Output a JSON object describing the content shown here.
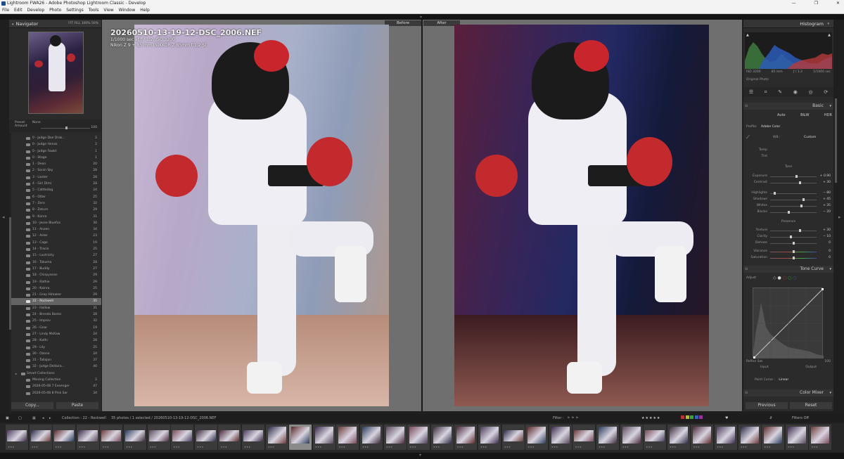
{
  "window": {
    "title": "Lightroom FWA26 - Adobe Photoshop Lightroom Classic - Develop"
  },
  "menu": [
    "File",
    "Edit",
    "Develop",
    "Photo",
    "Settings",
    "Tools",
    "View",
    "Window",
    "Help"
  ],
  "navigator": {
    "title": "Navigator",
    "zoom": "FIT  FILL  100%  50%"
  },
  "preset": {
    "label": "Preset:",
    "value": "None",
    "amount_label": "Amount",
    "amount_value": "100"
  },
  "collections": [
    {
      "name": "0 - Judge Doe Drak...",
      "count": "2"
    },
    {
      "name": "0 - Judge Henzo",
      "count": "2"
    },
    {
      "name": "0 - Judge Fawkt",
      "count": "1"
    },
    {
      "name": "0 - Stage",
      "count": "1"
    },
    {
      "name": "1 - Dean",
      "count": "20"
    },
    {
      "name": "2 - Sonin Sky",
      "count": "28"
    },
    {
      "name": "3 - Lanter",
      "count": "28"
    },
    {
      "name": "4 - Girl Dimi",
      "count": "28"
    },
    {
      "name": "5 - Cattledog",
      "count": "24"
    },
    {
      "name": "6 - Otter",
      "count": "25"
    },
    {
      "name": "7 - Zero",
      "count": "32"
    },
    {
      "name": "8 - Zaturn",
      "count": "29"
    },
    {
      "name": "9 - Kanra",
      "count": "31"
    },
    {
      "name": "10 - Jesse Bluefox",
      "count": "30"
    },
    {
      "name": "11 - Anzen",
      "count": "34"
    },
    {
      "name": "12 - Aster",
      "count": "23"
    },
    {
      "name": "13 - Cage",
      "count": "19"
    },
    {
      "name": "14 - Tracie",
      "count": "25"
    },
    {
      "name": "15 - Lustricity",
      "count": "27"
    },
    {
      "name": "16 - Takuma",
      "count": "28"
    },
    {
      "name": "17 - Buddy",
      "count": "27"
    },
    {
      "name": "18 - Chirpysean",
      "count": "29"
    },
    {
      "name": "19 - Rathie",
      "count": "29"
    },
    {
      "name": "20 - Kainra",
      "count": "25"
    },
    {
      "name": "21 - Gray Himaker",
      "count": "29"
    },
    {
      "name": "22 - Rockwell",
      "count": "35",
      "selected": true
    },
    {
      "name": "23 - Hallow",
      "count": "31"
    },
    {
      "name": "24 - Brenda Banks",
      "count": "28"
    },
    {
      "name": "25 - Improv",
      "count": "32"
    },
    {
      "name": "26 - Gnar",
      "count": "19"
    },
    {
      "name": "27 - Lindy McKaw",
      "count": "24"
    },
    {
      "name": "28 - Kathi",
      "count": "28"
    },
    {
      "name": "29 - Lily",
      "count": "25"
    },
    {
      "name": "30 - Ozone",
      "count": "24"
    },
    {
      "name": "31 - Tallajon",
      "count": "37"
    },
    {
      "name": "32 - Judge Dellaira...",
      "count": "40"
    },
    {
      "name": "Smart Collections",
      "count": "",
      "group": true
    },
    {
      "name": "Missing Collection",
      "count": "2"
    },
    {
      "name": "2026-05-08 7 Eesenger",
      "count": "47"
    },
    {
      "name": "2026-05-08 8 Pink Sar",
      "count": "34"
    }
  ],
  "left_buttons": {
    "copy": "Copy...",
    "paste": "Paste"
  },
  "view": {
    "before": "Before",
    "after": "After"
  },
  "photo_info": {
    "filename": "20260510-13-19-12-DSC_2006.NEF",
    "exposure": "1/1000 sec at ƒ / 1.2, ISO 3200",
    "lens": "Nikon Z 9 + 85 mm (NIKKOR Z 85mm f/1.2 S)"
  },
  "histogram": {
    "title": "Histogram",
    "iso": "ISO 3200",
    "focal": "85 mm",
    "aperture": "ƒ / 1.2",
    "shutter": "1/1000 sec",
    "original": "Original Photo"
  },
  "basic": {
    "title": "Basic",
    "treatment": [
      "Auto",
      "B&W",
      "HDR"
    ],
    "profile_label": "Profile:",
    "profile": "Adobe Color",
    "wb_label": "WB :",
    "wb": "Custom",
    "temp_label": "Temp",
    "tint_label": "Tint",
    "tone_label": "Tone",
    "presence_label": "Presence",
    "sliders": [
      {
        "label": "Exposure",
        "value": "+ 0.90",
        "pos": 0.57
      },
      {
        "label": "Contrast",
        "value": "+ 30",
        "pos": 0.65
      },
      {
        "label": "Highlights",
        "value": "− 80",
        "pos": 0.1
      },
      {
        "label": "Shadows",
        "value": "+ 45",
        "pos": 0.72
      },
      {
        "label": "Whites",
        "value": "+ 35",
        "pos": 0.67
      },
      {
        "label": "Blacks",
        "value": "− 20",
        "pos": 0.4
      },
      {
        "label": "Texture",
        "value": "+ 30",
        "pos": 0.65
      },
      {
        "label": "Clarity",
        "value": "− 10",
        "pos": 0.45
      },
      {
        "label": "Dehaze",
        "value": "0",
        "pos": 0.5
      },
      {
        "label": "Vibrance",
        "value": "0",
        "pos": 0.5
      },
      {
        "label": "Saturation",
        "value": "0",
        "pos": 0.5
      }
    ]
  },
  "tone_curve": {
    "title": "Tone Curve",
    "adjust": "Adjust",
    "refine": "Refine Sat.",
    "refine_val": "100",
    "input": "Input",
    "output": "Output",
    "point_curve_label": "Point Curve :",
    "point_curve": "Linear"
  },
  "color_mixer": {
    "title": "Color Mixer"
  },
  "right_buttons": {
    "previous": "Previous",
    "reset": "Reset"
  },
  "bottom_bar": {
    "collection": "Collection : 22 - Rockwell",
    "count": "35 photos / 1 selected / 20260510-13-19-12-DSC_2006.NEF",
    "filter_label": "Filter :",
    "filters_off": "Filters Off"
  },
  "colors": {
    "accent": "#b3b3b3",
    "panel": "#2b2b2b",
    "selected": "#646464"
  }
}
